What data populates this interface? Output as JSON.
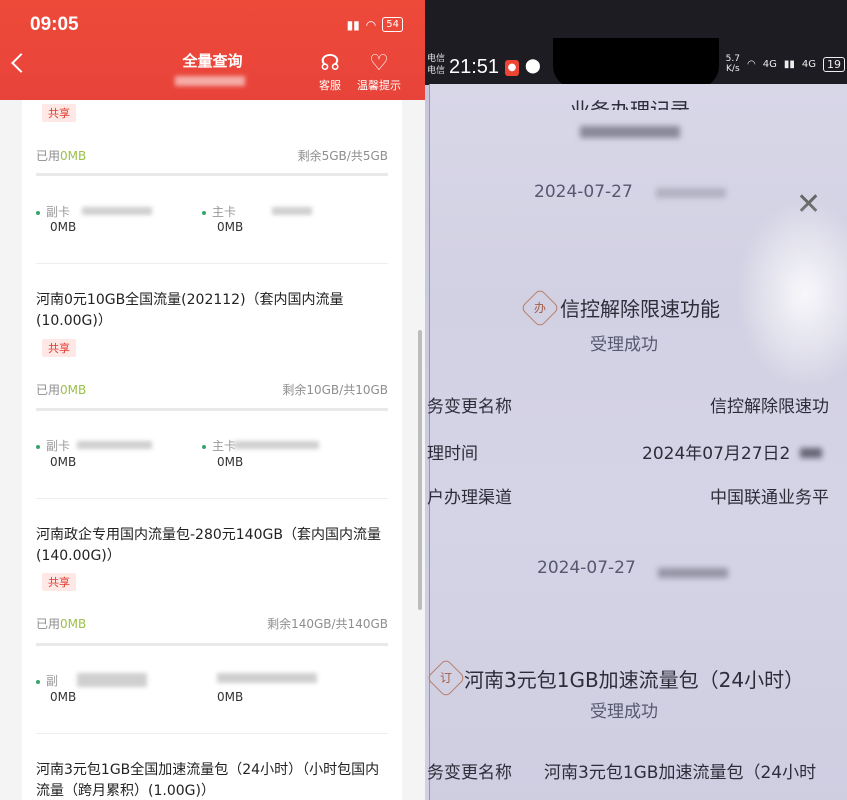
{
  "left": {
    "status": {
      "time": "09:05",
      "battery": "54"
    },
    "header": {
      "title": "全量查询",
      "service": "客服",
      "tips": "温馨提示"
    },
    "items": [
      {
        "tag": "共享",
        "used_label": "已用",
        "used": "0MB",
        "remain": "剩余5GB/共5GB",
        "members": [
          {
            "role": "副卡",
            "value": "0MB"
          },
          {
            "role": "主卡",
            "value": "0MB"
          }
        ]
      },
      {
        "title": "河南0元10GB全国流量(202112)（套内国内流量(10.00G)）",
        "tag": "共享",
        "used_label": "已用",
        "used": "0MB",
        "remain": "剩余10GB/共10GB",
        "members": [
          {
            "role": "副卡",
            "value": "0MB"
          },
          {
            "role": "主卡",
            "value": "0MB"
          }
        ]
      },
      {
        "title": "河南政企专用国内流量包-280元140GB（套内国内流量(140.00G)）",
        "tag": "共享",
        "used_label": "已用",
        "used": "0MB",
        "remain": "剩余140GB/共140GB",
        "members": [
          {
            "role": "副",
            "value": "0MB"
          },
          {
            "role": "",
            "value": "0MB"
          }
        ]
      },
      {
        "title": "河南3元包1GB全国加速流量包（24小时）（小时包国内流量（跨月累积）(1.00G)）"
      }
    ]
  },
  "right": {
    "status": {
      "carrier1": "电信",
      "carrier2": "电信",
      "time": "21:51",
      "speed": "5.7",
      "speed_unit": "K/s",
      "net1": "4G",
      "net2": "4G",
      "battery": "19"
    },
    "page_title": "业务办理记录",
    "records": [
      {
        "date": "2024-07-27",
        "icon": "办",
        "name": "信控解除限速功能",
        "status": "受理成功",
        "rows": [
          {
            "label": "务变更名称",
            "value": "信控解除限速功"
          },
          {
            "label": "理时间",
            "value": "2024年07月27日2"
          },
          {
            "label": "户办理渠道",
            "value": "中国联通业务平"
          }
        ]
      },
      {
        "date": "2024-07-27",
        "icon": "订",
        "name": "河南3元包1GB加速流量包（24小时）",
        "status": "受理成功",
        "rows": [
          {
            "label": "务变更名称",
            "value": "河南3元包1GB加速流量包（24小时"
          }
        ]
      }
    ]
  }
}
